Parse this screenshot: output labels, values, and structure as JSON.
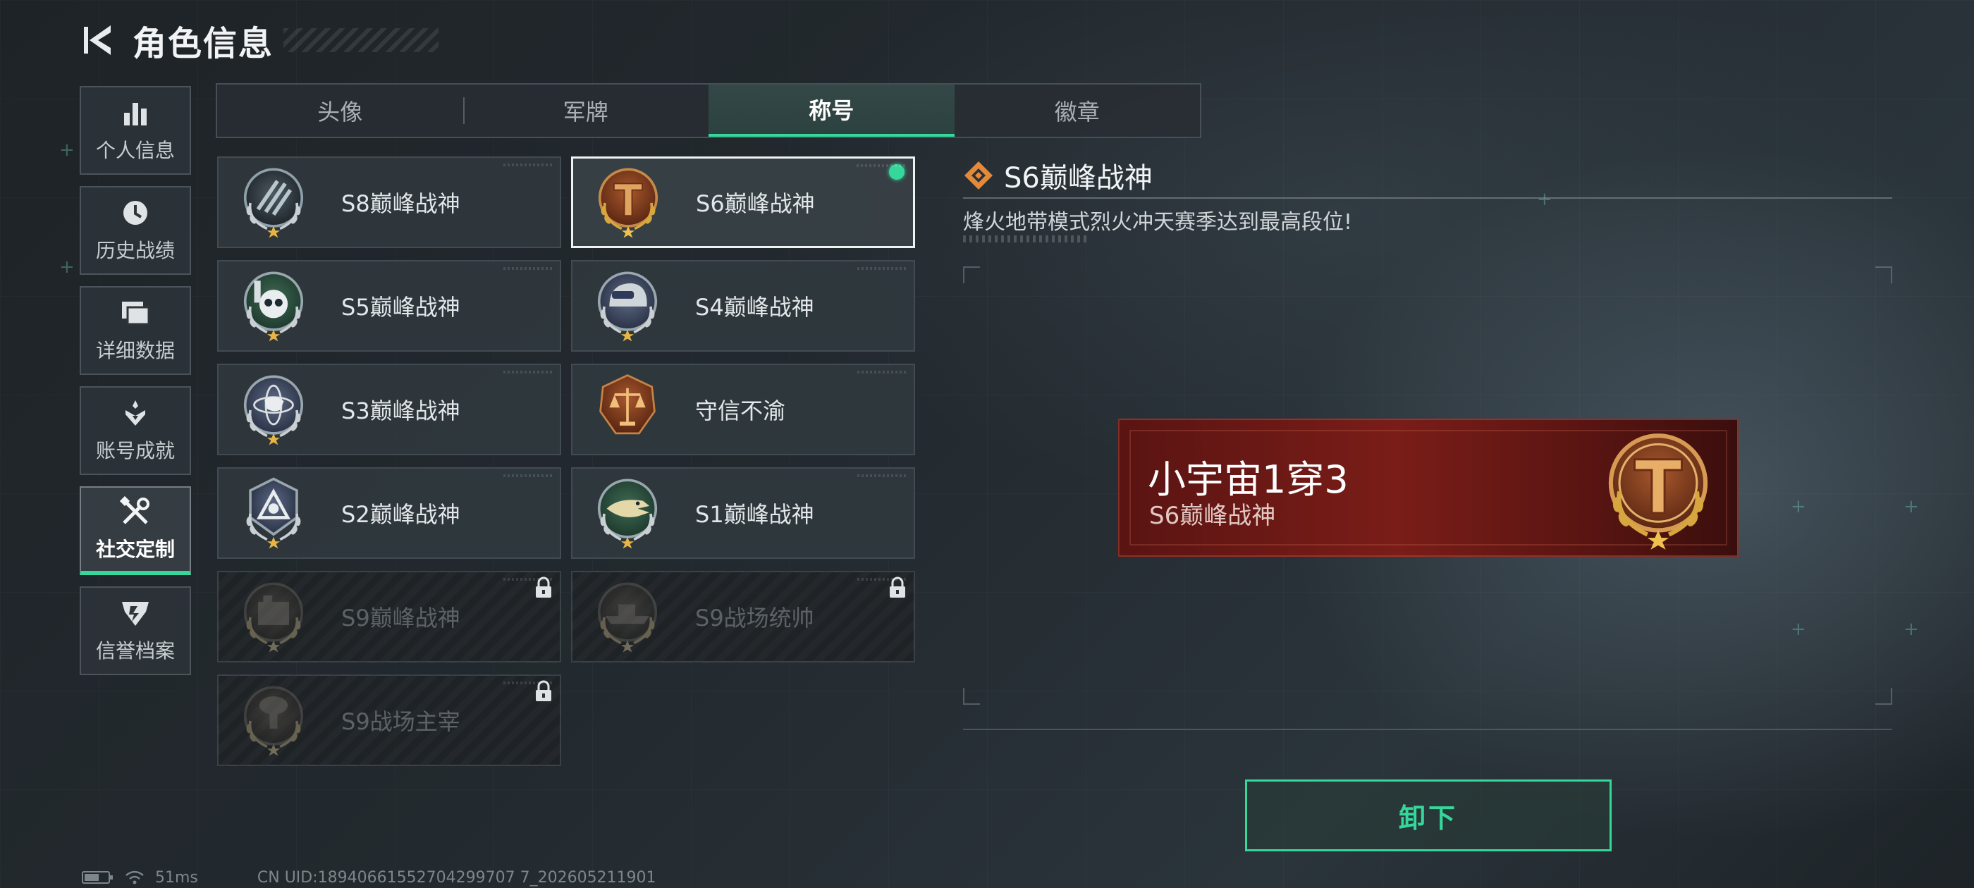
{
  "header": {
    "title": "角色信息"
  },
  "sidebar": {
    "items": [
      {
        "label": "个人信息",
        "icon": "bar-chart-icon"
      },
      {
        "label": "历史战绩",
        "icon": "clock-icon"
      },
      {
        "label": "详细数据",
        "icon": "folder-icon"
      },
      {
        "label": "账号成就",
        "icon": "achievement-icon"
      },
      {
        "label": "社交定制",
        "icon": "tools-icon",
        "active": true
      },
      {
        "label": "信誉档案",
        "icon": "shield-icon"
      }
    ]
  },
  "tabs": [
    {
      "label": "头像"
    },
    {
      "label": "军牌"
    },
    {
      "label": "称号",
      "active": true
    },
    {
      "label": "徽章"
    }
  ],
  "titles": [
    {
      "name": "S8巅峰战神",
      "emblem": "s8-emblem",
      "state": "normal"
    },
    {
      "name": "S6巅峰战神",
      "emblem": "s6-emblem",
      "state": "selected"
    },
    {
      "name": "S5巅峰战神",
      "emblem": "s5-emblem",
      "state": "normal"
    },
    {
      "name": "S4巅峰战神",
      "emblem": "s4-emblem",
      "state": "normal"
    },
    {
      "name": "S3巅峰战神",
      "emblem": "s3-emblem",
      "state": "normal"
    },
    {
      "name": "守信不渝",
      "emblem": "scale-emblem",
      "state": "normal"
    },
    {
      "name": "S2巅峰战神",
      "emblem": "s2-emblem",
      "state": "normal"
    },
    {
      "name": "S1巅峰战神",
      "emblem": "s1-emblem",
      "state": "normal"
    },
    {
      "name": "S9巅峰战神",
      "emblem": "s9-peak-emblem",
      "state": "locked"
    },
    {
      "name": "S9战场统帅",
      "emblem": "s9-commander-emblem",
      "state": "locked"
    },
    {
      "name": "S9战场主宰",
      "emblem": "s9-dominator-emblem",
      "state": "locked"
    }
  ],
  "detail": {
    "title": "S6巅峰战神",
    "description": "烽火地带模式烈火冲天赛季达到最高段位!"
  },
  "banner": {
    "player_name": "小宇宙1穿3",
    "title": "S6巅峰战神"
  },
  "actions": {
    "unequip_label": "卸下"
  },
  "status": {
    "ping": "51ms",
    "uid": "CN UID:18940661552704299707 7_202605211901"
  },
  "colors": {
    "accent": "#35d79b",
    "banner_red": "#7a1d18"
  }
}
